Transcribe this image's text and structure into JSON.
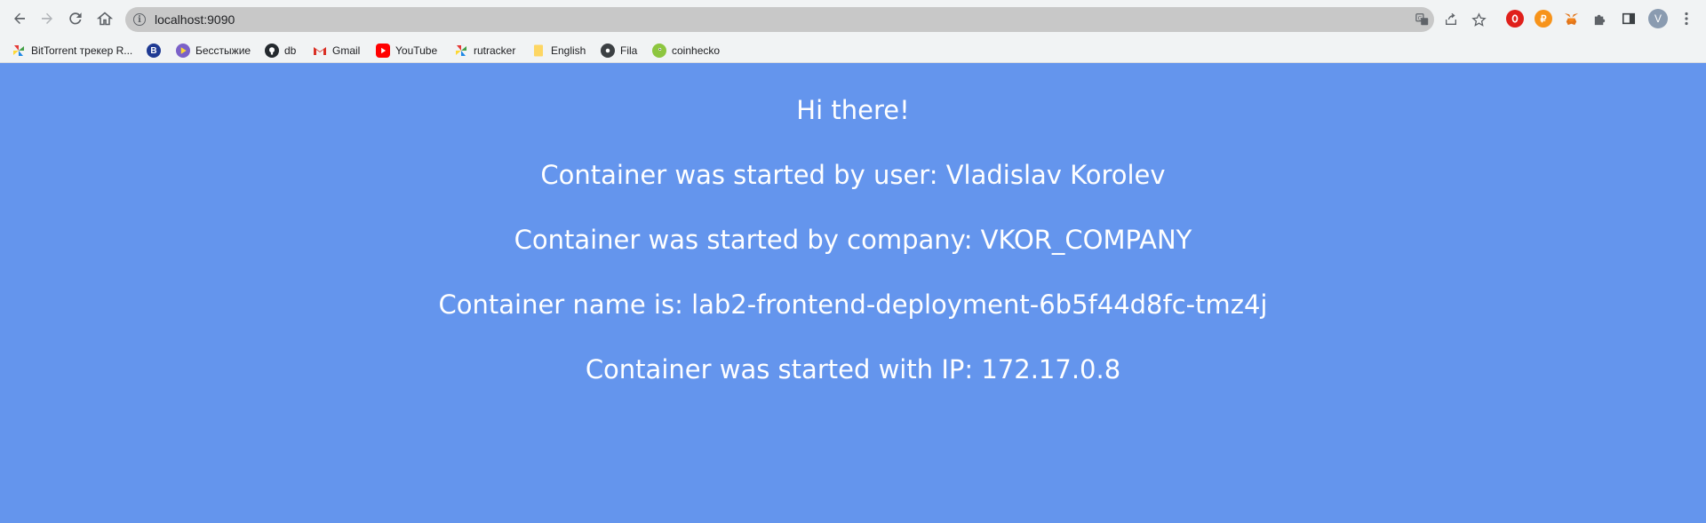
{
  "browser": {
    "url": "localhost:9090",
    "nav_icons": [
      "back-icon",
      "forward-icon",
      "reload-icon",
      "home-icon"
    ],
    "omnibox_icons": [
      "translate-icon",
      "share-icon",
      "bookmark-star-icon"
    ],
    "extension_icons": [
      "opera-extension-icon",
      "coin-extension-icon",
      "metamask-icon",
      "puzzle-icon",
      "sidepanel-icon"
    ],
    "avatar_letter": "V",
    "menu_icon": "more-vert-icon"
  },
  "bookmarks": [
    {
      "label": "BitTorrent трекер R...",
      "icon": "pinwheel-icon"
    },
    {
      "label": "",
      "icon": "hse-icon"
    },
    {
      "label": "Бесстыжие",
      "icon": "play-icon"
    },
    {
      "label": "db",
      "icon": "github-icon"
    },
    {
      "label": "Gmail",
      "icon": "gmail-icon"
    },
    {
      "label": "YouTube",
      "icon": "youtube-icon"
    },
    {
      "label": "rutracker",
      "icon": "pinwheel-icon"
    },
    {
      "label": "English",
      "icon": "folder-icon"
    },
    {
      "label": "Fila",
      "icon": "camera-icon"
    },
    {
      "label": "coinhecko",
      "icon": "coingecko-icon"
    }
  ],
  "page": {
    "greeting": "Hi there!",
    "user_line": "Container was started by user: Vladislav Korolev",
    "company_line": "Container was started by company: VKOR_COMPANY",
    "name_line": "Container name is: lab2-frontend-deployment-6b5f44d8fc-tmz4j",
    "ip_line": "Container was started with IP: 172.17.0.8"
  },
  "colors": {
    "page_background": "#6495ed",
    "text": "#ffffff"
  }
}
